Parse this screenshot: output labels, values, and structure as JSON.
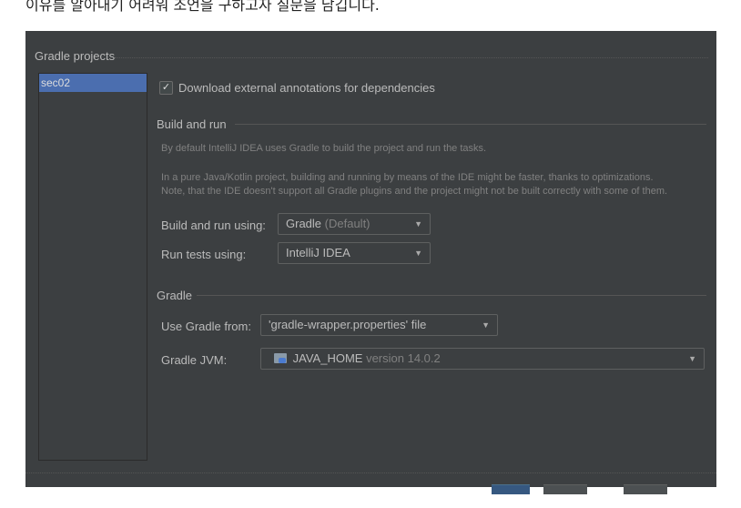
{
  "caption": "이유를 알아내기 어려워 조언을 구하고자 질문을 남깁니다.",
  "dialog": {
    "projects_title": "Gradle projects",
    "projects": [
      {
        "label": "sec02",
        "selected": true
      }
    ],
    "download_annotations": {
      "label": "Download external annotations for dependencies",
      "checked": true
    },
    "build_and_run": {
      "title": "Build and run",
      "hint1": "By default IntelliJ IDEA uses Gradle to build the project and run the tasks.",
      "hint2": "In a pure Java/Kotlin project, building and running by means of the IDE might be faster, thanks to optimizations.",
      "hint3": "Note, that the IDE doesn't support all Gradle plugins and the project might not be built correctly with some of them.",
      "build_run_label": "Build and run using:",
      "build_run_value": "Gradle",
      "build_run_suffix": "(Default)",
      "run_tests_label": "Run tests using:",
      "run_tests_value": "IntelliJ IDEA"
    },
    "gradle": {
      "title": "Gradle",
      "use_from_label": "Use Gradle from:",
      "use_from_value": "'gradle-wrapper.properties' file",
      "jvm_label": "Gradle JVM:",
      "jvm_value": "JAVA_HOME",
      "jvm_suffix": "version 14.0.2"
    },
    "colors": {
      "background": "#3c3f41",
      "selection": "#4b6eaf",
      "primary_button": "#365880"
    }
  }
}
